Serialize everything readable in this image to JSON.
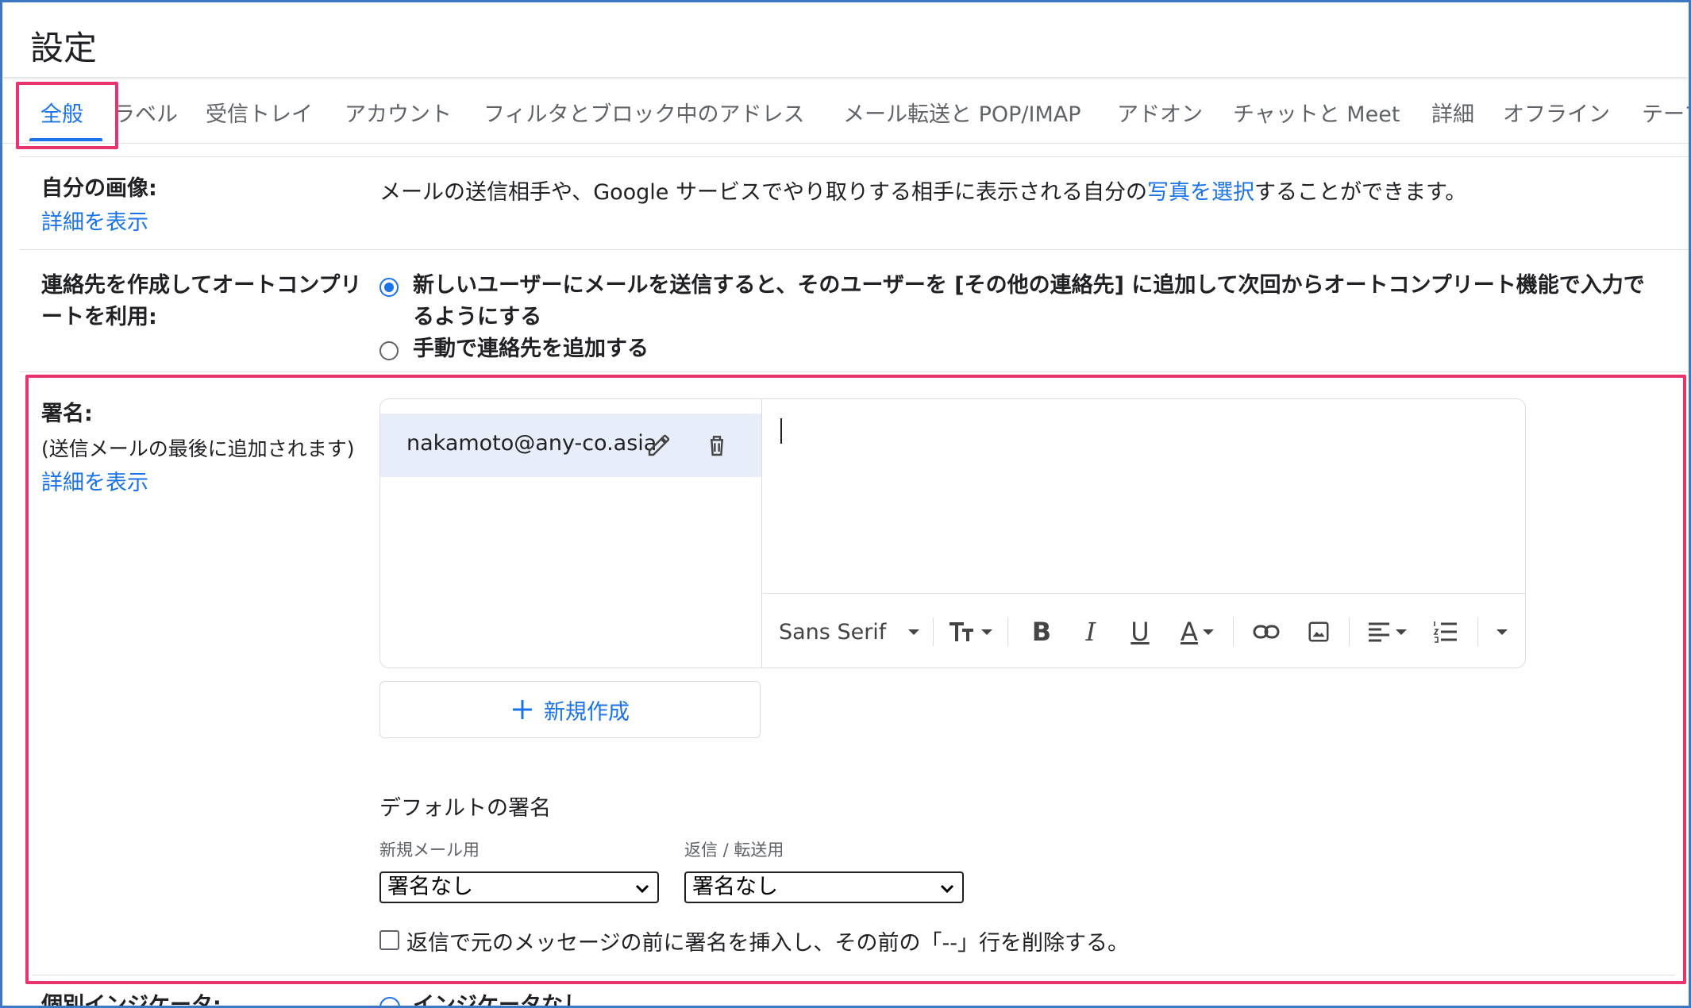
{
  "header": {
    "title": "設定"
  },
  "tabs": [
    {
      "label": "全般",
      "active": true
    },
    {
      "label": "ラベル"
    },
    {
      "label": "受信トレイ"
    },
    {
      "label": "アカウント"
    },
    {
      "label": "フィルタとブロック中のアドレス"
    },
    {
      "label": "メール転送と POP/IMAP"
    },
    {
      "label": "アドオン"
    },
    {
      "label": "チャットと Meet"
    },
    {
      "label": "詳細"
    },
    {
      "label": "オフライン"
    },
    {
      "label": "テーマ"
    }
  ],
  "my_picture": {
    "label": "自分の画像:",
    "more_link": "詳細を表示",
    "desc_before": "メールの送信相手や、Google サービスでやり取りする相手に表示される自分の",
    "desc_link": "写真を選択",
    "desc_after": "することができます。"
  },
  "autocomplete": {
    "label_line1": "連絡先を作成してオートコンプリ",
    "label_line2": "ートを利用:",
    "option1_line1": "新しいユーザーにメールを送信すると、そのユーザーを [その他の連絡先] に追加して次回からオートコンプリート機能で入力で",
    "option1_line2": "るようにする",
    "option2": "手動で連絡先を追加する"
  },
  "signature": {
    "label": "署名:",
    "sublabel": "(送信メールの最後に追加されます)",
    "more_link": "詳細を表示",
    "items": [
      {
        "name": "nakamoto@any-co.asia"
      }
    ],
    "font": "Sans Serif",
    "new_button": "新規作成",
    "default_title": "デフォルトの署名",
    "new_mail_label": "新規メール用",
    "reply_label": "返信 / 転送用",
    "new_mail_value": "署名なし",
    "reply_value": "署名なし",
    "insert_before_quote": "返信で元のメッセージの前に署名を挿入し、その前の「--」行を削除する。"
  },
  "indicator": {
    "label": "個別インジケータ:",
    "option1": "インジケータなし"
  },
  "colors": {
    "accent": "#1a73e8",
    "highlight": "#e8336d",
    "frame": "#3f78c2"
  }
}
